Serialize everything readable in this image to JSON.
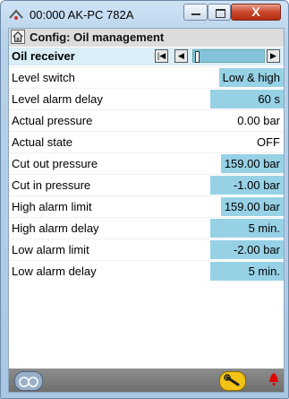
{
  "window": {
    "title": "00:000 AK-PC 782A",
    "minimize_glyph": "—",
    "maximize_glyph": "□",
    "close_glyph": "X"
  },
  "header": {
    "icon": "home-icon",
    "title": "Config: Oil management"
  },
  "nav": {
    "label": "Oil receiver",
    "first_glyph": "|◀",
    "prev_glyph": "◀",
    "next_glyph": "▶"
  },
  "rows": [
    {
      "label": "Level switch",
      "value": "Low & high",
      "editable": true
    },
    {
      "label": "Level alarm delay",
      "value": "60 s",
      "editable": true
    },
    {
      "label": "Actual pressure",
      "value": "0.00 bar",
      "editable": false
    },
    {
      "label": "Actual state",
      "value": "OFF",
      "editable": false
    },
    {
      "label": "Cut out pressure",
      "value": "159.00 bar",
      "editable": true
    },
    {
      "label": "Cut in pressure",
      "value": "-1.00 bar",
      "editable": true
    },
    {
      "label": "High alarm limit",
      "value": "159.00 bar",
      "editable": true
    },
    {
      "label": "High alarm delay",
      "value": "5 min.",
      "editable": true
    },
    {
      "label": "Low alarm limit",
      "value": "-2.00 bar",
      "editable": true
    },
    {
      "label": "Low alarm delay",
      "value": "5 min.",
      "editable": true
    }
  ],
  "footer": {
    "left_icon": "glasses-icon",
    "wrench_icon": "wrench-icon",
    "alarm_icon": "bell-icon",
    "accent_blue": "#97d1e5",
    "alarm_color": "#e00000"
  }
}
